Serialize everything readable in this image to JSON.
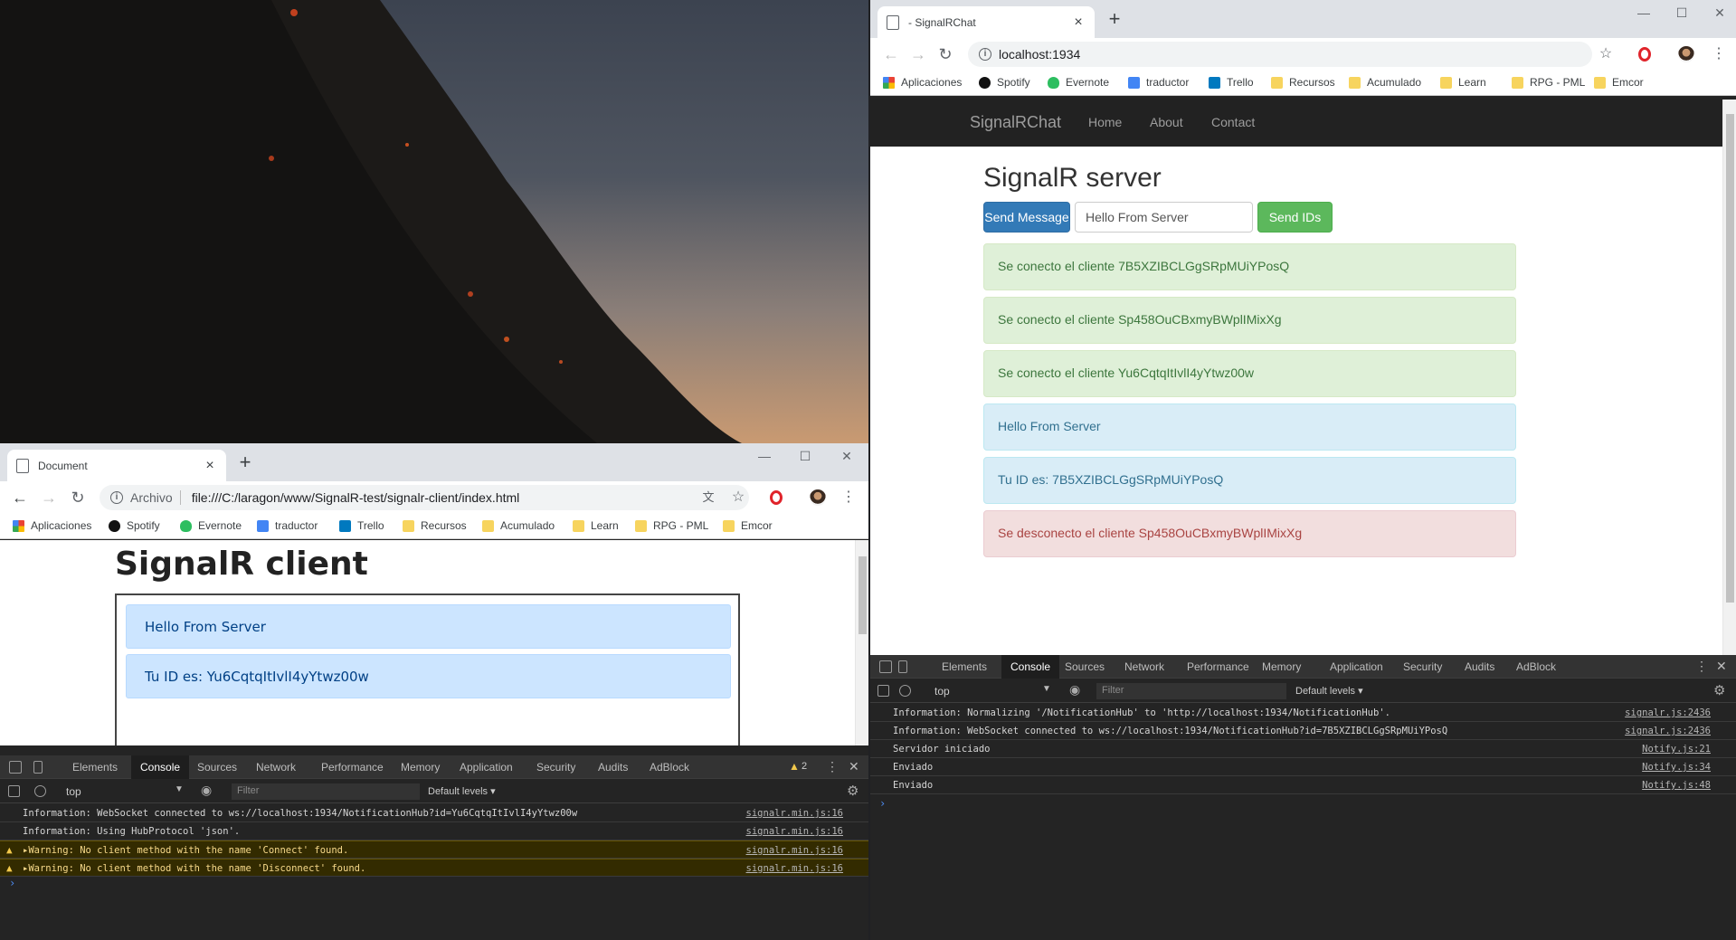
{
  "server_window": {
    "tab_title": "- SignalRChat",
    "address": "localhost:1934",
    "bookmarks": [
      "Aplicaciones",
      "Spotify",
      "Evernote",
      "traductor",
      "Trello",
      "Recursos",
      "Acumulado",
      "Learn",
      "RPG - PML",
      "Emcor"
    ],
    "navbar": {
      "brand": "SignalRChat",
      "links": [
        "Home",
        "About",
        "Contact"
      ]
    },
    "heading": "SignalR server",
    "send_message_label": "Send Message",
    "message_input_value": "Hello From Server",
    "send_ids_label": "Send IDs",
    "alerts": [
      {
        "type": "success",
        "text": "Se conecto el cliente 7B5XZIBCLGgSRpMUiYPosQ"
      },
      {
        "type": "success",
        "text": "Se conecto el cliente Sp458OuCBxmyBWplIMixXg"
      },
      {
        "type": "success",
        "text": "Se conecto el cliente Yu6CqtqItIvlI4yYtwz00w"
      },
      {
        "type": "info",
        "text": "Hello From Server"
      },
      {
        "type": "info",
        "text": "Tu ID es: 7B5XZIBCLGgSRpMUiYPosQ"
      },
      {
        "type": "danger",
        "text": "Se desconecto el cliente Sp458OuCBxmyBWplIMixXg"
      }
    ],
    "devtools": {
      "tabs": [
        "Elements",
        "Console",
        "Sources",
        "Network",
        "Performance",
        "Memory",
        "Application",
        "Security",
        "Audits",
        "AdBlock"
      ],
      "active_tab": "Console",
      "context": "top",
      "filter_placeholder": "Filter",
      "levels": "Default levels ▾",
      "lines": [
        {
          "msg": "Information: Normalizing '/NotificationHub' to 'http://localhost:1934/NotificationHub'.",
          "src": "signalr.js:2436"
        },
        {
          "msg": "Information: WebSocket connected to ws://localhost:1934/NotificationHub?id=7B5XZIBCLGgSRpMUiYPosQ",
          "src": "signalr.js:2436"
        },
        {
          "msg": "Servidor iniciado",
          "src": "Notify.js:21"
        },
        {
          "msg": "Enviado",
          "src": "Notify.js:34"
        },
        {
          "msg": "Enviado",
          "src": "Notify.js:48"
        }
      ],
      "prompt": "›"
    }
  },
  "client_window": {
    "tab_title": "Document",
    "address_prefix": "Archivo",
    "address": "file:///C:/laragon/www/SignalR-test/signalr-client/index.html",
    "bookmarks": [
      "Aplicaciones",
      "Spotify",
      "Evernote",
      "traductor",
      "Trello",
      "Recursos",
      "Acumulado",
      "Learn",
      "RPG - PML",
      "Emcor"
    ],
    "heading": "SignalR client",
    "messages": [
      "Hello From Server",
      "Tu ID es: Yu6CqtqItIvlI4yYtwz00w"
    ],
    "devtools": {
      "tabs": [
        "Elements",
        "Console",
        "Sources",
        "Network",
        "Performance",
        "Memory",
        "Application",
        "Security",
        "Audits",
        "AdBlock"
      ],
      "active_tab": "Console",
      "warning_count": "2",
      "context": "top",
      "filter_placeholder": "Filter",
      "levels": "Default levels ▾",
      "lines": [
        {
          "level": "info",
          "msg": "Information: WebSocket connected to ws://localhost:1934/NotificationHub?id=Yu6CqtqItIvlI4yYtwz00w",
          "src": "signalr.min.js:16"
        },
        {
          "level": "info",
          "msg": "Information: Using HubProtocol 'json'.",
          "src": "signalr.min.js:16"
        },
        {
          "level": "warn",
          "msg": "▸Warning: No client method with the name 'Connect' found.",
          "src": "signalr.min.js:16"
        },
        {
          "level": "warn",
          "msg": "▸Warning: No client method with the name 'Disconnect' found.",
          "src": "signalr.min.js:16"
        }
      ],
      "prompt": "›"
    }
  },
  "colors": {
    "primary": "#337ab7",
    "success_btn": "#5cb85c",
    "warning": "#f2c94c",
    "prompt": "#4d8bf0"
  }
}
